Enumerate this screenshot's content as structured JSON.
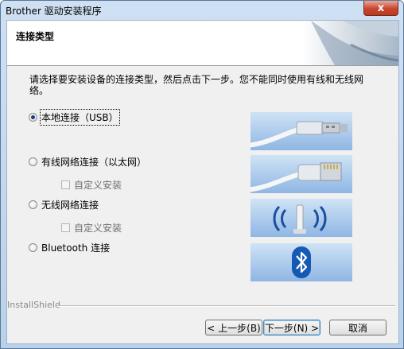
{
  "window": {
    "title": "Brother 驱动安装程序",
    "close_label": "x"
  },
  "header": {
    "title": "连接类型"
  },
  "instruction": "请选择要安装设备的连接类型，然后点击下一步。您不能同时使用有线和无线网络。",
  "options": [
    {
      "label": "本地连接（USB）",
      "selected": true,
      "icon": "usb-cable-image"
    },
    {
      "label": "有线网络连接（以太网）",
      "selected": false,
      "icon": "ethernet-cable-image"
    },
    {
      "label": "无线网络连接",
      "selected": false,
      "icon": "wireless-access-point-image"
    },
    {
      "label": "Bluetooth 连接",
      "selected": false,
      "icon": "bluetooth-image"
    }
  ],
  "custom_install": [
    {
      "label": "自定义安装",
      "checked": false,
      "enabled": false
    },
    {
      "label": "自定义安装",
      "checked": false,
      "enabled": false
    }
  ],
  "footer": {
    "brand": "InstallShield",
    "back": "< 上一步(B)",
    "next": "下一步(N) >",
    "cancel": "取消"
  },
  "colors": {
    "bluetooth": "#1559b3",
    "selected_radio": "#1b3a82"
  }
}
